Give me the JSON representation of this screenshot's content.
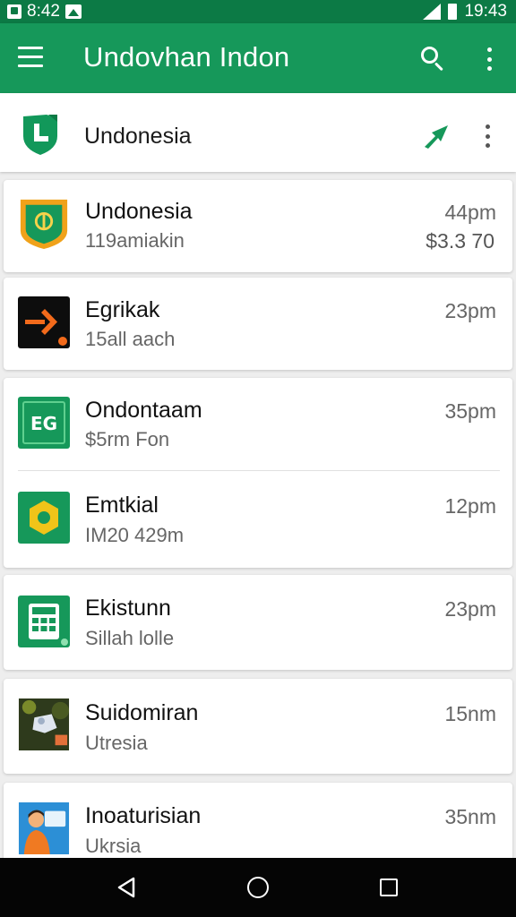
{
  "status_bar": {
    "left_text": "8:42",
    "time": "19:43"
  },
  "app_bar": {
    "title": "Undovhan Indon",
    "menu_icon": "menu-icon",
    "search_icon": "search-icon",
    "overflow_icon": "more-vertical-icon"
  },
  "sub_header": {
    "title": "Undonesia",
    "logo_icon": "shield-logo-icon",
    "pin_icon": "arrow-up-right-icon",
    "overflow_icon": "more-vertical-icon"
  },
  "items": [
    {
      "title": "Undonesia",
      "subtitle": "119amiakin",
      "time": "44pm",
      "amount": "$3.3 70",
      "icon": "shield-app-icon"
    },
    {
      "title": "Egrikak",
      "subtitle": "15all aach",
      "time": "23pm",
      "icon": "arrow-app-icon"
    },
    {
      "title": "Ondontaam",
      "subtitle": "$5rm Fon",
      "time": "35pm",
      "icon": "eg-app-icon"
    },
    {
      "title": "Emtkial",
      "subtitle": "IM20 429m",
      "time": "12pm",
      "icon": "hexagon-app-icon"
    },
    {
      "title": "Ekistunn",
      "subtitle": "Sillah lolle",
      "time": "23pm",
      "icon": "calculator-app-icon"
    },
    {
      "title": "Suidomiran",
      "subtitle": "Utresia",
      "time": "15nm",
      "icon": "photo-thumbnail-icon"
    },
    {
      "title": "Inoaturisian",
      "subtitle": "Ukrsia",
      "time": "35nm",
      "icon": "avatar-thumbnail-icon"
    }
  ],
  "nav_bar": {
    "back_icon": "back-icon",
    "home_icon": "home-icon",
    "recents_icon": "recents-icon"
  },
  "colors": {
    "status_bar": "#0c7a45",
    "app_bar": "#16985a",
    "accent": "#16985a"
  }
}
